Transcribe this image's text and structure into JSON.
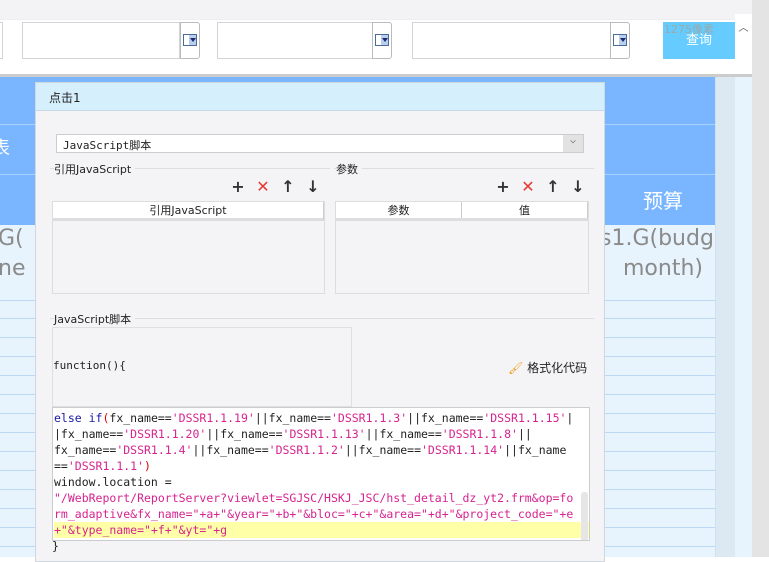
{
  "toolbar": {
    "query_label": "查询",
    "width_hint": "1275像素"
  },
  "background": {
    "header_right": "预算",
    "cell_right_1": "s1.G(budg",
    "cell_right_2": "month)",
    "cell_left_1": "G(",
    "cell_left_2": "ne",
    "header_left": "表"
  },
  "dialog": {
    "title": "点击1",
    "type_select": "JavaScript脚本",
    "ref_group_label": "引用JavaScript",
    "param_group_label": "参数",
    "ref_table": {
      "columns": [
        "引用JavaScript"
      ],
      "rows": []
    },
    "param_table": {
      "columns": [
        "参数",
        "值"
      ],
      "rows": []
    },
    "script_group_label": "JavaScript脚本",
    "function_header": "function(){",
    "format_button": "格式化代码",
    "code_close": "}",
    "icons": [
      "plus-icon",
      "delete-icon",
      "arrow-up-icon",
      "arrow-down-icon"
    ],
    "code_lines": [
      "else if(fx_name=='DSSR1.1.19'||fx_name=='DSSR1.1.3'||fx_name=='DSSR1.1.15'|",
      "|fx_name=='DSSR1.1.20'||fx_name=='DSSR1.1.13'||fx_name=='DSSR1.1.8'||",
      "fx_name=='DSSR1.1.4'||fx_name=='DSSR1.1.2'||fx_name=='DSSR1.1.14'||fx_name",
      "=='DSSR1.1.1')",
      "window.location =",
      "\"/WebReport/ReportServer?viewlet=SGJSC/HSKJ_JSC/hst_detail_dz_yt2.frm&op=fo",
      "rm_adaptive&fx_name=\"+a+\"&year=\"+b+\"&bloc=\"+c+\"&area=\"+d+\"&project_code=\"+e",
      "+\"&type_name=\"+f+\"&yt=\"+g"
    ]
  },
  "colors": {
    "accent": "#66ccff",
    "header_blue": "#7ab6ff",
    "delete_red": "#e53935"
  }
}
